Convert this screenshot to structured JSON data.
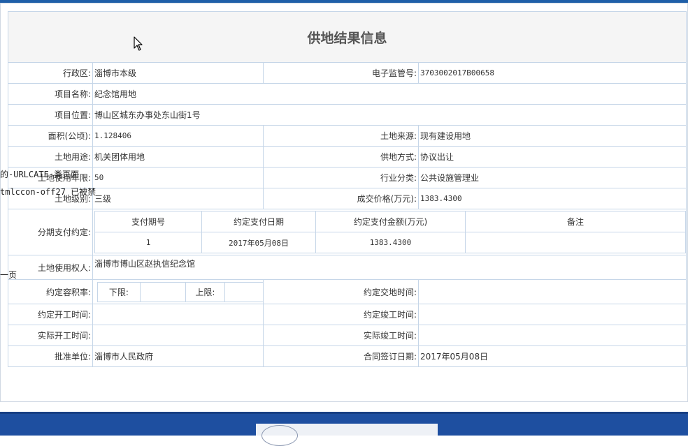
{
  "title": "供地结果信息",
  "fields": {
    "district_label": "行政区:",
    "district_value": "淄博市本级",
    "supervision_no_label": "电子监管号:",
    "supervision_no_value": "3703002017B00658",
    "project_name_label": "项目名称:",
    "project_name_value": "纪念馆用地",
    "project_location_label": "项目位置:",
    "project_location_value": "博山区城东办事处东山街1号",
    "area_label": "面积(公顷):",
    "area_value": "1.128406",
    "land_source_label": "土地来源:",
    "land_source_value": "现有建设用地",
    "land_use_label": "土地用途:",
    "land_use_value": "机关团体用地",
    "supply_method_label": "供地方式:",
    "supply_method_value": "协议出让",
    "use_term_label": "土地使用年限:",
    "use_term_value": "50",
    "industry_label": "行业分类:",
    "industry_value": "公共设施管理业",
    "land_grade_label": "土地级别:",
    "land_grade_value": "三级",
    "price_label": "成交价格(万元):",
    "price_value": "1383.4300",
    "installment_label": "分期支付约定:",
    "land_user_label": "土地使用权人:",
    "land_user_value": "淄博市博山区赵执信纪念馆",
    "far_label": "约定容积率:",
    "far_lower_label": "下限:",
    "far_lower_value": "",
    "far_upper_label": "上限:",
    "far_upper_value": "",
    "delivery_time_label": "约定交地时间:",
    "delivery_time_value": "",
    "agreed_start_label": "约定开工时间:",
    "agreed_start_value": "",
    "agreed_completion_label": "约定竣工时间:",
    "agreed_completion_value": "",
    "actual_start_label": "实际开工时间:",
    "actual_start_value": "",
    "actual_completion_label": "实际竣工时间:",
    "actual_completion_value": "",
    "approval_unit_label": "批准单位:",
    "approval_unit_value": "淄博市人民政府",
    "contract_date_label": "合同签订日期:",
    "contract_date_value": "2017年05月08日"
  },
  "installments": {
    "headers": [
      "支付期号",
      "约定支付日期",
      "约定支付金额(万元)",
      "备注"
    ],
    "rows": [
      [
        "1",
        "2017年05月08日",
        "1383.4300",
        ""
      ]
    ]
  },
  "overlay_text": {
    "line1": "的-URLCATE-类页面",
    "line2": "tmlccon-off27",
    "line2_suffix": " 已被禁",
    "line3": "一页"
  },
  "icons": {
    "cursor": "mouse-pointer-icon"
  },
  "colors": {
    "border": "#c6d6e8",
    "title_bg": "#f5f5f5",
    "footer_bg": "#1e4fa0"
  }
}
